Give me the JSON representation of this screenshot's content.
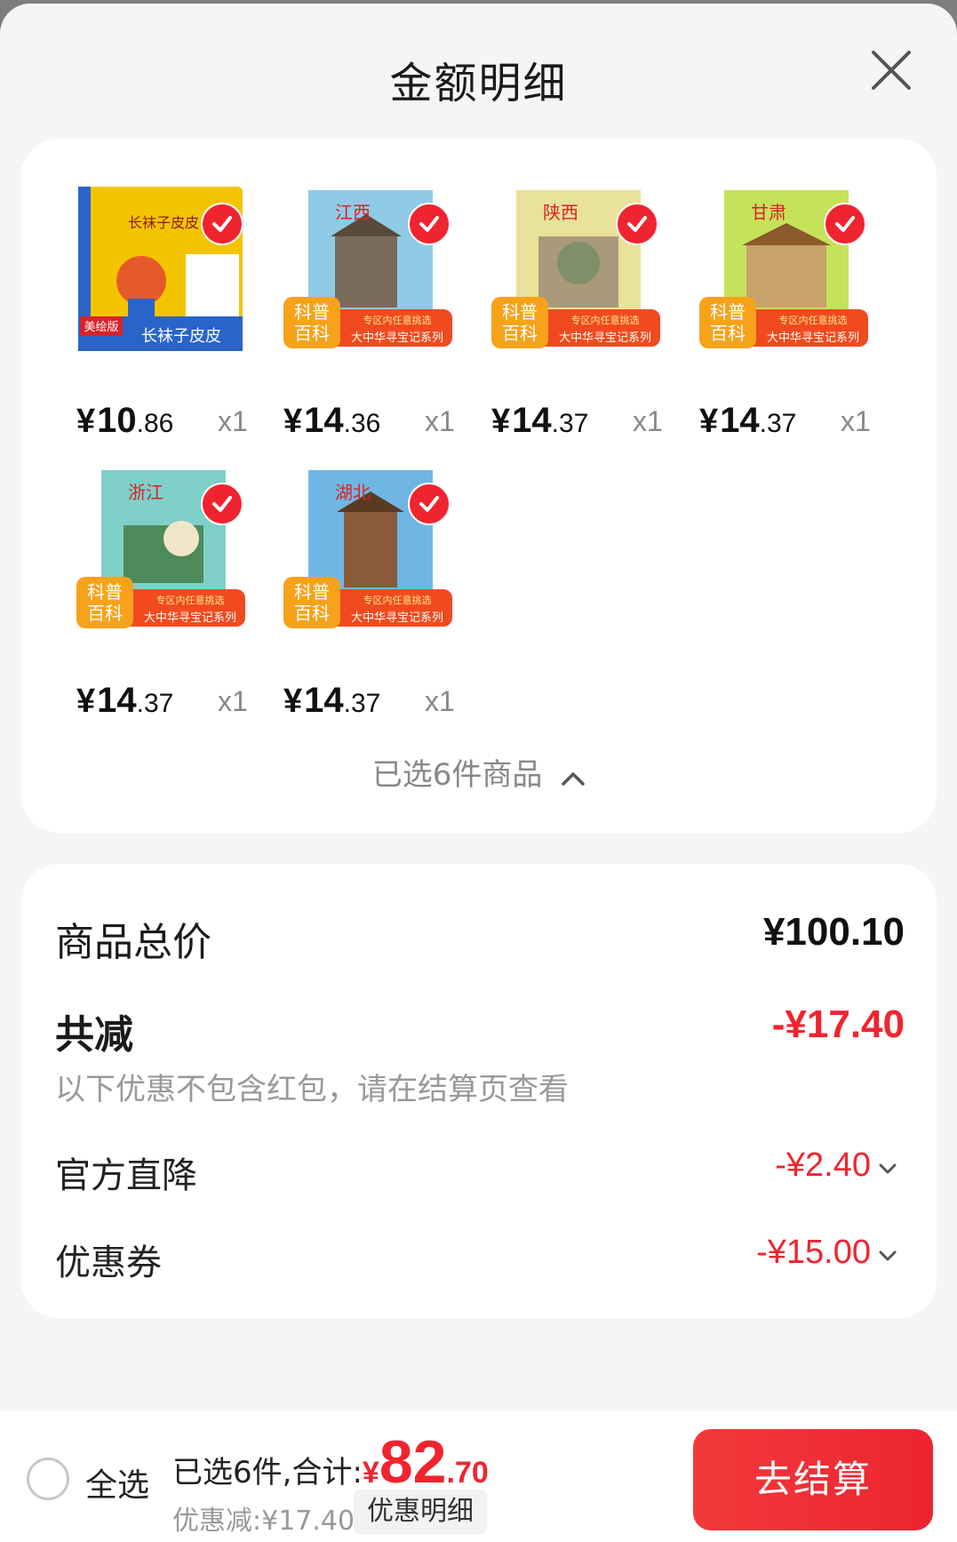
{
  "sheet": {
    "title": "金额明细"
  },
  "items": [
    {
      "title": "长袜子皮皮",
      "price_int": "10",
      "price_dec": ".86",
      "currency": "¥",
      "qty": "x1",
      "cover_color": "#f5c400"
    },
    {
      "title": "江西",
      "price_int": "14",
      "price_dec": ".36",
      "currency": "¥",
      "qty": "x1",
      "cover_color": "#8fcbe6"
    },
    {
      "title": "陕西",
      "price_int": "14",
      "price_dec": ".37",
      "currency": "¥",
      "qty": "x1",
      "cover_color": "#e9e29a"
    },
    {
      "title": "甘肃",
      "price_int": "14",
      "price_dec": ".37",
      "currency": "¥",
      "qty": "x1",
      "cover_color": "#c6e25a"
    },
    {
      "title": "浙江",
      "price_int": "14",
      "price_dec": ".37",
      "currency": "¥",
      "qty": "x1",
      "cover_color": "#7fd0c9"
    },
    {
      "title": "湖北",
      "price_int": "14",
      "price_dec": ".37",
      "currency": "¥",
      "qty": "x1",
      "cover_color": "#6fb7e3"
    }
  ],
  "cover_text": {
    "pippi_header": "长袜子皮皮",
    "pippi_badge": "美绘版",
    "pippi_footer": "长袜子皮皮",
    "series_badge_1": "科普",
    "series_badge_2": "百科",
    "series_tag": "专区内任意挑选",
    "series_name": "大中华寻宝记系列"
  },
  "selected_summary": "已选6件商品",
  "summary": {
    "total_label": "商品总价",
    "total_value": "¥100.10",
    "reduce_label": "共减",
    "reduce_value": "-¥17.40",
    "note": "以下优惠不包含红包，请在结算页查看",
    "official_label": "官方直降",
    "official_value": "-¥2.40",
    "coupon_label": "优惠券",
    "coupon_value": "-¥15.00"
  },
  "bottom_bar": {
    "select_all": "全选",
    "total_label": "已选6件,合计:",
    "total_currency": "¥",
    "total_int": "82",
    "total_dec": ".70",
    "discount": "优惠减:¥17.40",
    "detail_button": "优惠明细",
    "checkout_button": "去结算"
  },
  "colors": {
    "accent": "#f0242f",
    "check": "#f0242f"
  }
}
